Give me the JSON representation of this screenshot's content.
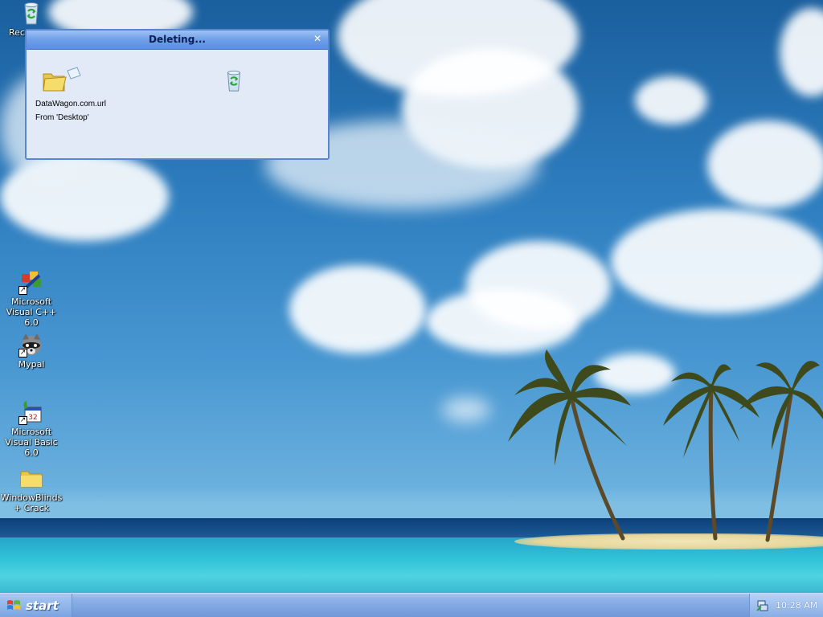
{
  "desktop": {
    "icons": [
      {
        "label": "Rec",
        "icon": "recycle-bin-icon"
      },
      {
        "label": "Microsoft Visual C++ 6.0",
        "icon": "visual-cpp-icon"
      },
      {
        "label": "Mypal",
        "icon": "mypal-raccoon-icon"
      },
      {
        "label": "Microsoft Visual Basic 6.0",
        "icon": "visual-basic-icon"
      },
      {
        "label": "WindowBlinds + Crack",
        "icon": "folder-icon"
      }
    ]
  },
  "dialog": {
    "title": "Deleting...",
    "file_name": "DataWagon.com.url",
    "from_text": "From 'Desktop'",
    "icons": [
      "flying-folder-icon",
      "recycle-bin-icon",
      "close-icon"
    ]
  },
  "taskbar": {
    "start_label": "start",
    "clock": "10:28 AM",
    "icons": [
      "windows-logo-icon",
      "tray-network-icon"
    ]
  },
  "colors": {
    "taskbar": "#7ea6e0",
    "dialog_title": "#6f9fe8",
    "dialog_body": "#e2eaf8",
    "sky": "#2f7fc0",
    "sea": "#31c3d9"
  }
}
